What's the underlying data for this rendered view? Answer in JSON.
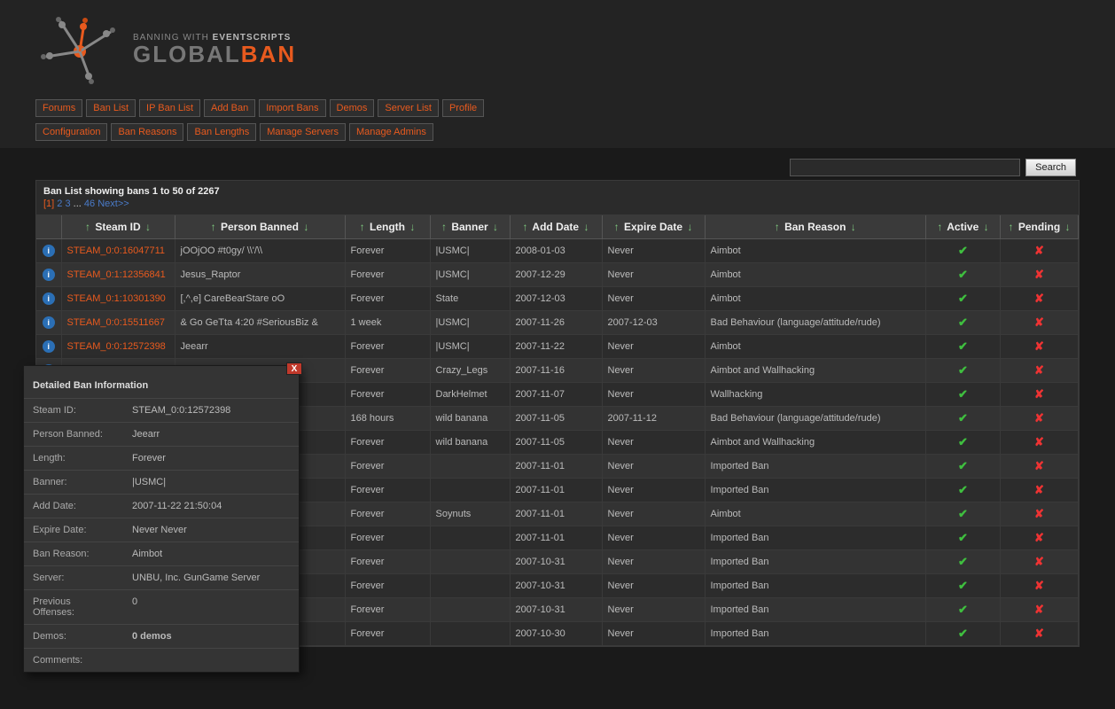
{
  "brand": {
    "tagline_pre": "BANNING WITH ",
    "tagline_bold": "EVENTSCRIPTS",
    "name_a": "GLOBAL",
    "name_b": "BAN"
  },
  "nav": {
    "row1": [
      "Forums",
      "Ban List",
      "IP Ban List",
      "Add Ban",
      "Import Bans",
      "Demos",
      "Server List",
      "Profile"
    ],
    "row2": [
      "Configuration",
      "Ban Reasons",
      "Ban Lengths",
      "Manage Servers",
      "Manage Admins"
    ]
  },
  "search": {
    "button": "Search",
    "value": ""
  },
  "list": {
    "title": "Ban List showing bans 1 to 50 of 2267",
    "pagination": {
      "current": "[1]",
      "p2": "2",
      "p3": "3",
      "dots": "...",
      "last": "46",
      "next": "Next>>"
    }
  },
  "columns": [
    "Steam ID",
    "Person Banned",
    "Length",
    "Banner",
    "Add Date",
    "Expire Date",
    "Ban Reason",
    "Active",
    "Pending"
  ],
  "rows": [
    {
      "steam": "STEAM_0:0:16047711",
      "person": "jOOjOO #t0gy/ \\\\'/\\\\",
      "length": "Forever",
      "banner": "|USMC|",
      "add": "2008-01-03",
      "expire": "Never",
      "reason": "Aimbot",
      "active": true,
      "pending": false
    },
    {
      "steam": "STEAM_0:1:12356841",
      "person": "Jesus_Raptor",
      "length": "Forever",
      "banner": "|USMC|",
      "add": "2007-12-29",
      "expire": "Never",
      "reason": "Aimbot",
      "active": true,
      "pending": false
    },
    {
      "steam": "STEAM_0:1:10301390",
      "person": "[,^,e] CareBearStare oO",
      "length": "Forever",
      "banner": "State",
      "add": "2007-12-03",
      "expire": "Never",
      "reason": "Aimbot",
      "active": true,
      "pending": false
    },
    {
      "steam": "STEAM_0:0:15511667",
      "person": "& Go GeTta 4:20 #SeriousBiz &",
      "length": "1 week",
      "banner": "|USMC|",
      "add": "2007-11-26",
      "expire": "2007-12-03",
      "reason": "Bad Behaviour (language/attitude/rude)",
      "active": true,
      "pending": false
    },
    {
      "steam": "STEAM_0:0:12572398",
      "person": "Jeearr",
      "length": "Forever",
      "banner": "|USMC|",
      "add": "2007-11-22",
      "expire": "Never",
      "reason": "Aimbot",
      "active": true,
      "pending": false
    },
    {
      "steam": "",
      "person": "",
      "length": "Forever",
      "banner": "Crazy_Legs",
      "add": "2007-11-16",
      "expire": "Never",
      "reason": "Aimbot and Wallhacking",
      "active": true,
      "pending": false
    },
    {
      "steam": "",
      "person": "",
      "length": "Forever",
      "banner": "DarkHelmet",
      "add": "2007-11-07",
      "expire": "Never",
      "reason": "Wallhacking",
      "active": true,
      "pending": false
    },
    {
      "steam": "",
      "person": "",
      "length": "168 hours",
      "banner": "wild banana",
      "add": "2007-11-05",
      "expire": "2007-11-12",
      "reason": "Bad Behaviour (language/attitude/rude)",
      "active": true,
      "pending": false
    },
    {
      "steam": "",
      "person": "",
      "length": "Forever",
      "banner": "wild banana",
      "add": "2007-11-05",
      "expire": "Never",
      "reason": "Aimbot and Wallhacking",
      "active": true,
      "pending": false
    },
    {
      "steam": "",
      "person": "",
      "length": "Forever",
      "banner": "",
      "add": "2007-11-01",
      "expire": "Never",
      "reason": "Imported Ban",
      "active": true,
      "pending": false
    },
    {
      "steam": "",
      "person": "",
      "length": "Forever",
      "banner": "",
      "add": "2007-11-01",
      "expire": "Never",
      "reason": "Imported Ban",
      "active": true,
      "pending": false
    },
    {
      "steam": "",
      "person": "",
      "length": "Forever",
      "banner": "Soynuts",
      "add": "2007-11-01",
      "expire": "Never",
      "reason": "Aimbot",
      "active": true,
      "pending": false
    },
    {
      "steam": "",
      "person": "",
      "length": "Forever",
      "banner": "",
      "add": "2007-11-01",
      "expire": "Never",
      "reason": "Imported Ban",
      "active": true,
      "pending": false
    },
    {
      "steam": "",
      "person": "",
      "length": "Forever",
      "banner": "",
      "add": "2007-10-31",
      "expire": "Never",
      "reason": "Imported Ban",
      "active": true,
      "pending": false
    },
    {
      "steam": "",
      "person": "",
      "length": "Forever",
      "banner": "",
      "add": "2007-10-31",
      "expire": "Never",
      "reason": "Imported Ban",
      "active": true,
      "pending": false
    },
    {
      "steam": "",
      "person": "",
      "length": "Forever",
      "banner": "",
      "add": "2007-10-31",
      "expire": "Never",
      "reason": "Imported Ban",
      "active": true,
      "pending": false
    },
    {
      "steam": "",
      "person": "",
      "length": "Forever",
      "banner": "",
      "add": "2007-10-30",
      "expire": "Never",
      "reason": "Imported Ban",
      "active": true,
      "pending": false
    }
  ],
  "popup": {
    "title": "Detailed Ban Information",
    "fields": [
      {
        "label": "Steam ID:",
        "value": "STEAM_0:0:12572398"
      },
      {
        "label": "Person Banned:",
        "value": "Jeearr"
      },
      {
        "label": "Length:",
        "value": "Forever"
      },
      {
        "label": "Banner:",
        "value": "|USMC|"
      },
      {
        "label": "Add Date:",
        "value": "2007-11-22 21:50:04"
      },
      {
        "label": "Expire Date:",
        "value": "Never Never"
      },
      {
        "label": "Ban Reason:",
        "value": "Aimbot"
      },
      {
        "label": "Server:",
        "value": "UNBU, Inc. GunGame Server"
      },
      {
        "label": "Previous Offenses:",
        "value": "0"
      },
      {
        "label": "Demos:",
        "value": "0 demos"
      },
      {
        "label": "Comments:",
        "value": ""
      }
    ]
  }
}
